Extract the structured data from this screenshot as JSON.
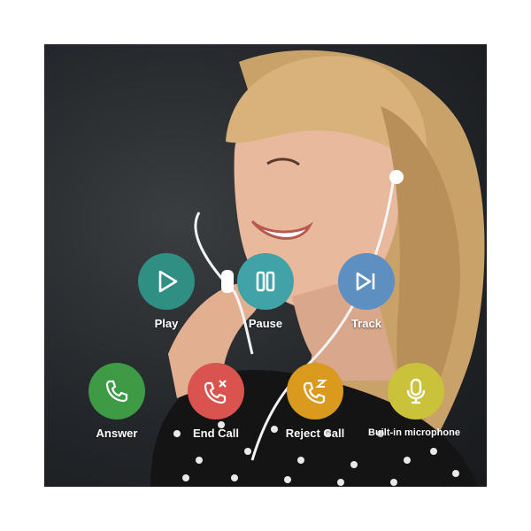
{
  "colors": {
    "play": "#2f8f83",
    "pause": "#3fa3a8",
    "track": "#5d8fc0",
    "answer": "#3f9a46",
    "end_call": "#d9534f",
    "reject_call": "#d99a1e",
    "microphone": "#c9c23a"
  },
  "controls": {
    "play": {
      "label": "Play",
      "icon": "play-icon"
    },
    "pause": {
      "label": "Pause",
      "icon": "pause-icon"
    },
    "track": {
      "label": "Track",
      "icon": "skip-track-icon"
    },
    "answer": {
      "label": "Answer",
      "icon": "phone-icon"
    },
    "end_call": {
      "label": "End Call",
      "icon": "phone-end-icon"
    },
    "reject_call": {
      "label": "Reject Call",
      "icon": "phone-reject-icon"
    },
    "microphone": {
      "label": "Built-in microphone",
      "icon": "microphone-icon"
    }
  }
}
